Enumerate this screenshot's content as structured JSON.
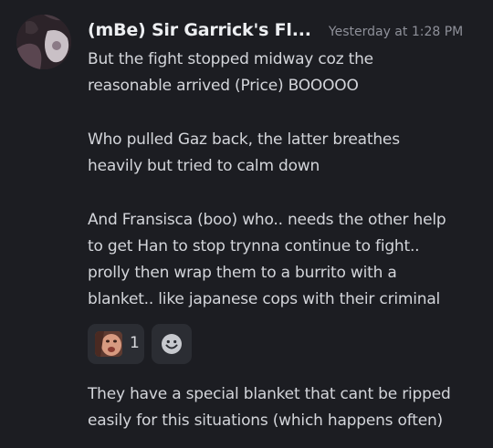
{
  "message": {
    "username": "(mBe) Sir Garrick's Fl...",
    "timestamp": "Yesterday at 1:28 PM",
    "paragraphs": [
      [
        "But the fight stopped midway coz the",
        "reasonable arrived (Price) BOOOOO"
      ],
      [
        "Who pulled Gaz back, the latter breathes",
        "heavily but tried to calm down"
      ],
      [
        "And Fransisca (boo) who.. needs the other help",
        "to get Han to stop trynna continue to fight..",
        "prolly then wrap them to a burrito with a",
        "blanket.. like japanese cops with their criminal"
      ],
      [
        "They have a special blanket that cant be ripped",
        "easily for this situations (which happens often)"
      ]
    ]
  },
  "reactions": [
    {
      "emoji_icon": "face-emoji-icon",
      "count": "1"
    }
  ],
  "add_reaction_icon": "smiley-icon",
  "colors": {
    "background": "#1c1d22",
    "username": "#eceef1",
    "timestamp": "#8e9099",
    "text": "#d3d5da",
    "reaction_bg": "#2b2d33"
  }
}
